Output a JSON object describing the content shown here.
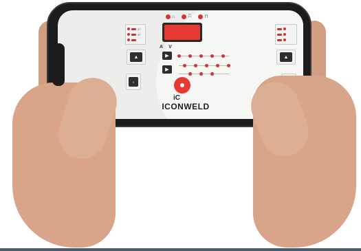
{
  "brand": {
    "logo_text": "ICONWELD",
    "logo_mark": "iC",
    "accent_color": "#e53a33",
    "screen_color": "#ededeb"
  },
  "display": {
    "top_indicators": [
      {
        "icon": "thermometer-icon"
      },
      {
        "icon": "current-icon"
      },
      {
        "icon": "gas-icon"
      }
    ],
    "value": ""
  },
  "parameters": [
    "A",
    "V"
  ],
  "left_panel": {
    "modes": [
      "2T",
      "4T"
    ],
    "up_button_icon": "triangle-up-icon"
  },
  "right_panel": {
    "up_button_icon": "triangle-up-icon"
  },
  "controls": {
    "play_icon": "play-icon",
    "power_icon": "power-button-icon"
  }
}
